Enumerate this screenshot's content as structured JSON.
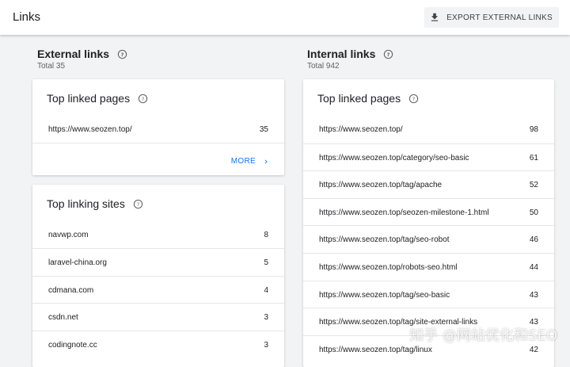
{
  "header": {
    "title": "Links",
    "export_label": "EXPORT EXTERNAL LINKS"
  },
  "external": {
    "title": "External links",
    "total": "Total 35",
    "top_linked_pages": {
      "title": "Top linked pages",
      "rows": [
        {
          "url": "https://www.seozen.top/",
          "count": "35"
        }
      ],
      "more_label": "MORE"
    },
    "top_linking_sites": {
      "title": "Top linking sites",
      "rows": [
        {
          "url": "navwp.com",
          "count": "8"
        },
        {
          "url": "laravel-china.org",
          "count": "5"
        },
        {
          "url": "cdmana.com",
          "count": "4"
        },
        {
          "url": "csdn.net",
          "count": "3"
        },
        {
          "url": "codingnote.cc",
          "count": "3"
        }
      ]
    }
  },
  "internal": {
    "title": "Internal links",
    "total": "Total 942",
    "top_linked_pages": {
      "title": "Top linked pages",
      "rows": [
        {
          "url": "https://www.seozen.top/",
          "count": "98"
        },
        {
          "url": "https://www.seozen.top/category/seo-basic",
          "count": "61"
        },
        {
          "url": "https://www.seozen.top/tag/apache",
          "count": "52"
        },
        {
          "url": "https://www.seozen.top/seozen-milestone-1.html",
          "count": "50"
        },
        {
          "url": "https://www.seozen.top/tag/seo-robot",
          "count": "46"
        },
        {
          "url": "https://www.seozen.top/robots-seo.html",
          "count": "44"
        },
        {
          "url": "https://www.seozen.top/tag/seo-basic",
          "count": "43"
        },
        {
          "url": "https://www.seozen.top/tag/site-external-links",
          "count": "43"
        },
        {
          "url": "https://www.seozen.top/tag/linux",
          "count": "42"
        }
      ]
    }
  },
  "watermark": "知乎 @网站优化和SEO",
  "colors": {
    "accent": "#1a73e8",
    "background": "#f1f3f4"
  }
}
